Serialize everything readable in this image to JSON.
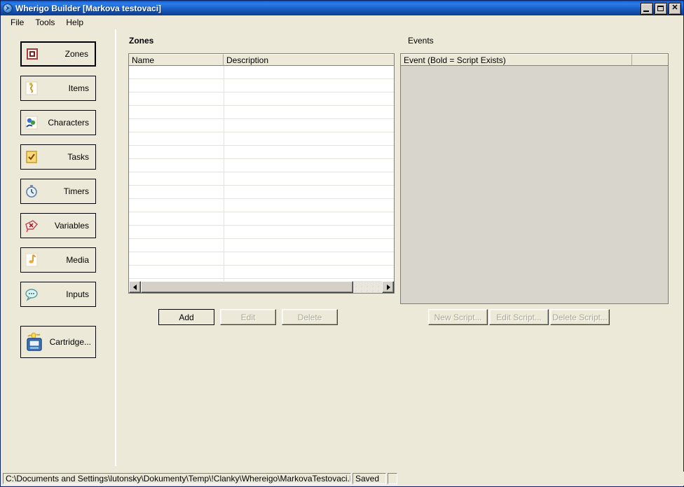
{
  "window": {
    "title": "Wherigo Builder [Markova testovaci]",
    "app_icon": "wherigo-globe-icon",
    "controls": {
      "minimize": "minimize-icon",
      "maximize": "maximize-icon",
      "close": "close-icon"
    }
  },
  "menu": {
    "items": [
      {
        "label": "File"
      },
      {
        "label": "Tools"
      },
      {
        "label": "Help"
      }
    ]
  },
  "sidebar": {
    "items": [
      {
        "label": "Zones",
        "icon": "zone-square-icon",
        "selected": true
      },
      {
        "label": "Items",
        "icon": "item-key-icon",
        "selected": false
      },
      {
        "label": "Characters",
        "icon": "characters-icon",
        "selected": false
      },
      {
        "label": "Tasks",
        "icon": "task-checkbox-icon",
        "selected": false
      },
      {
        "label": "Timers",
        "icon": "timer-clock-icon",
        "selected": false
      },
      {
        "label": "Variables",
        "icon": "variables-tag-icon",
        "selected": false
      },
      {
        "label": "Media",
        "icon": "media-note-icon",
        "selected": false
      },
      {
        "label": "Inputs",
        "icon": "input-bubble-icon",
        "selected": false
      }
    ],
    "cartridge": {
      "label": "Cartridge...",
      "icon": "cartridge-icon"
    }
  },
  "zones_panel": {
    "title": "Zones",
    "columns": [
      {
        "label": "Name"
      },
      {
        "label": "Description"
      }
    ],
    "rows": [],
    "buttons": [
      {
        "label": "Add",
        "enabled": true,
        "name": "add-button"
      },
      {
        "label": "Edit",
        "enabled": false,
        "name": "edit-button"
      },
      {
        "label": "Delete",
        "enabled": false,
        "name": "delete-button"
      }
    ],
    "scrollbar": {
      "name": "zones-horizontal-scrollbar"
    }
  },
  "events_panel": {
    "title": "Events",
    "columns": [
      {
        "label": "Event (Bold = Script Exists)"
      },
      {
        "label": ""
      }
    ],
    "rows": [],
    "buttons": [
      {
        "label": "New Script...",
        "enabled": false,
        "name": "new-script-button"
      },
      {
        "label": "Edit Script...",
        "enabled": false,
        "name": "edit-script-button"
      },
      {
        "label": "Delete Script...",
        "enabled": false,
        "name": "delete-script-button"
      }
    ]
  },
  "statusbar": {
    "path": "C:\\Documents and Settings\\lutonsky\\Dokumenty\\Temp\\!Clanky\\Whereigo\\MarkovaTestovaci.lua",
    "state": "Saved"
  },
  "colors": {
    "title_bar": "#1b60c8",
    "face": "#ece9d8",
    "disabled_face": "#d8d5cd",
    "list_bg": "#ffffff",
    "grid_line": "#e4e2dc",
    "disabled_text": "#aca899"
  }
}
